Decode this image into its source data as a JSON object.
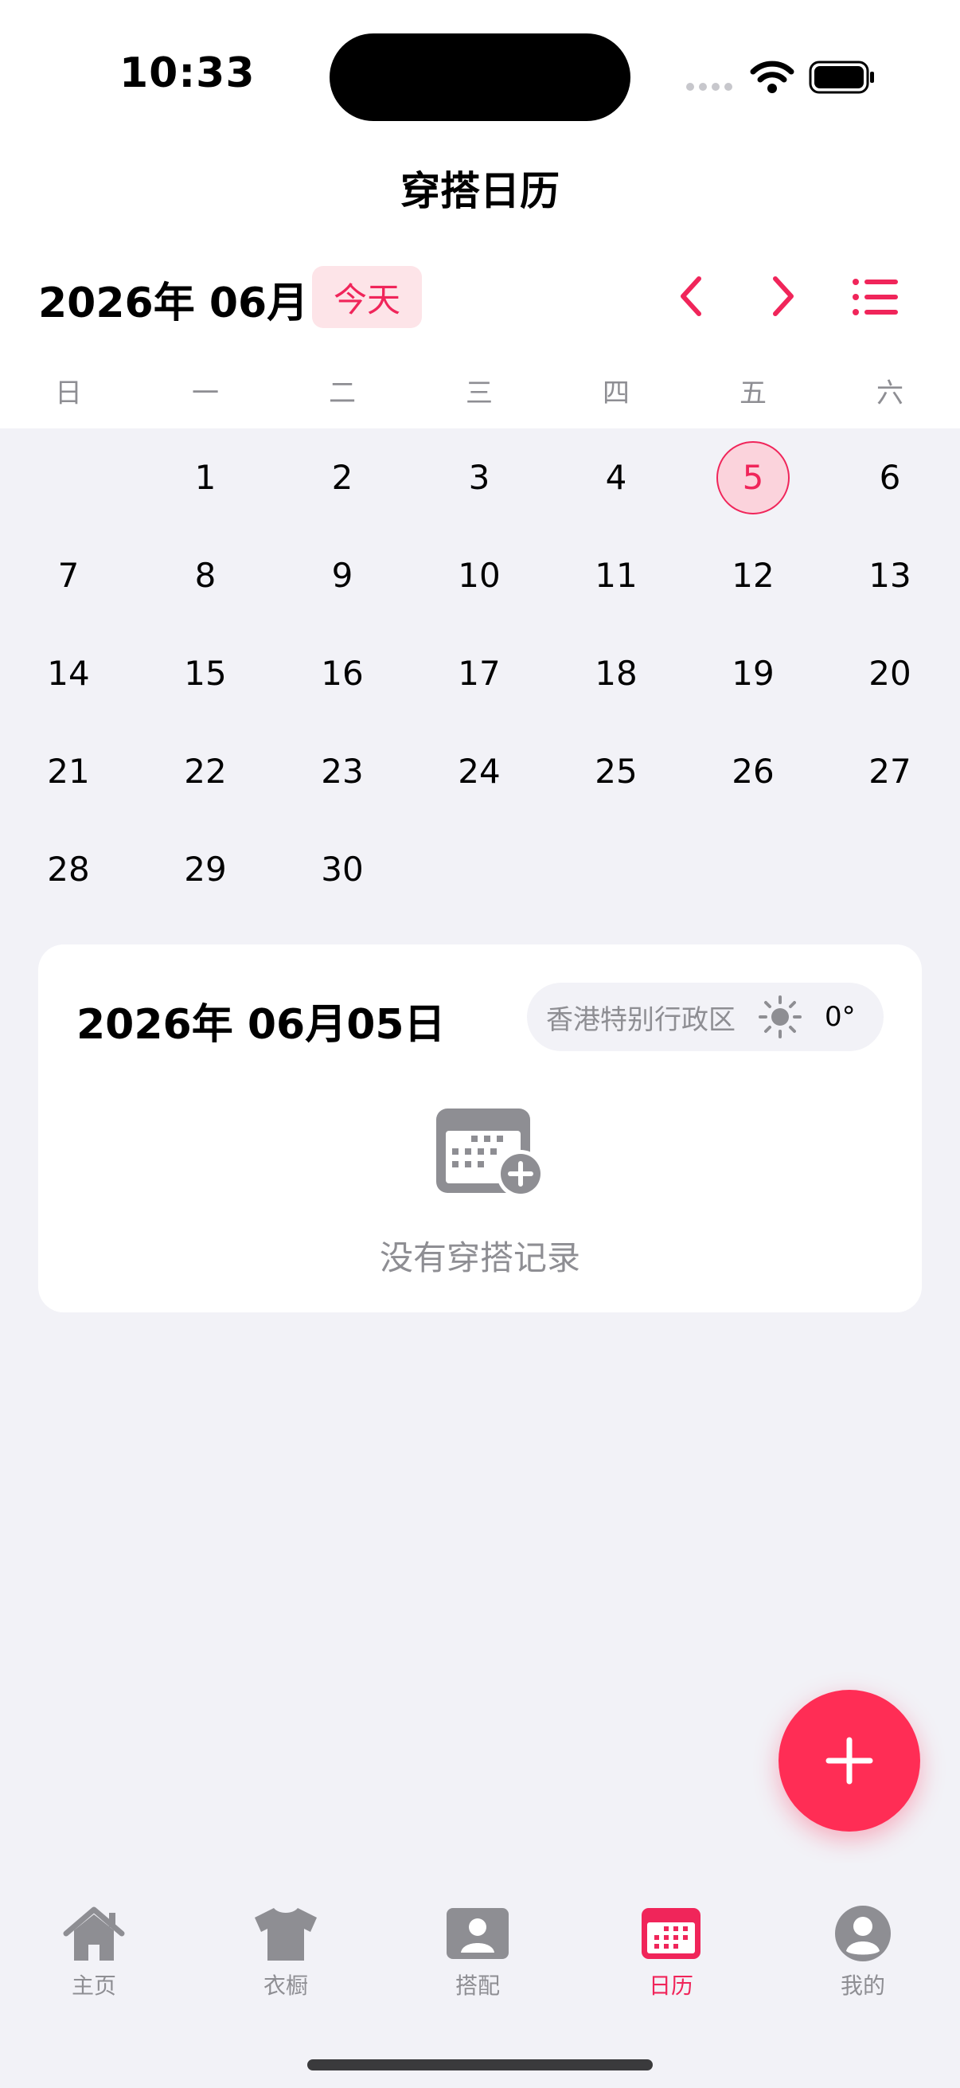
{
  "status": {
    "time": "10:33"
  },
  "nav": {
    "title": "穿搭日历"
  },
  "header": {
    "month_label": "2026年 06月",
    "today_label": "今天"
  },
  "weekdays": [
    "日",
    "一",
    "二",
    "三",
    "四",
    "五",
    "六"
  ],
  "calendar": {
    "selected_day": "5",
    "days": [
      "1",
      "2",
      "3",
      "4",
      "5",
      "6",
      "7",
      "8",
      "9",
      "10",
      "11",
      "12",
      "13",
      "14",
      "15",
      "16",
      "17",
      "18",
      "19",
      "20",
      "21",
      "22",
      "23",
      "24",
      "25",
      "26",
      "27",
      "28",
      "29",
      "30"
    ]
  },
  "detail": {
    "date_label": "2026年 06月05日",
    "location": "香港特别行政区",
    "temperature": "0°",
    "empty_text": "没有穿搭记录"
  },
  "tabs": [
    {
      "label": "主页",
      "icon": "house-icon"
    },
    {
      "label": "衣橱",
      "icon": "tshirt-icon"
    },
    {
      "label": "搭配",
      "icon": "person-card-icon"
    },
    {
      "label": "日历",
      "icon": "calendar-icon",
      "active": true
    },
    {
      "label": "我的",
      "icon": "person-circle-icon"
    }
  ],
  "colors": {
    "accent": "#f0255a",
    "fab": "#ff2d55",
    "background": "#f2f2f7",
    "muted": "#8e8e93"
  }
}
